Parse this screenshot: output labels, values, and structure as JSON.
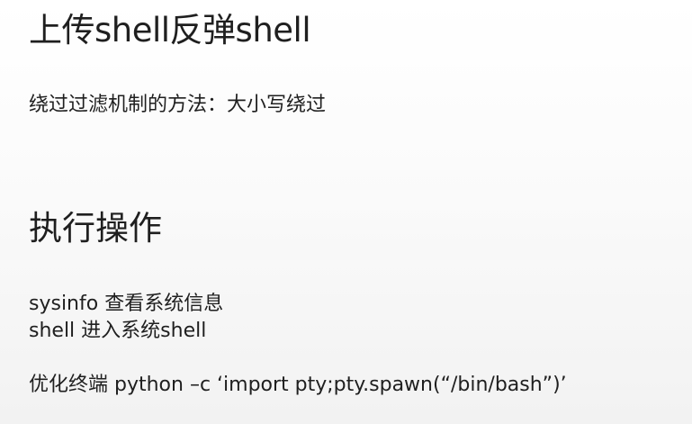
{
  "slide": {
    "title": "上传shell反弹shell",
    "bypass_method": "绕过过滤机制的方法：大小写绕过",
    "section_heading": "执行操作",
    "commands": [
      "sysinfo  查看系统信息",
      "shell 进入系统shell",
      "优化终端 python –c   ‘import pty;pty.spawn(“/bin/bash”)’"
    ]
  }
}
